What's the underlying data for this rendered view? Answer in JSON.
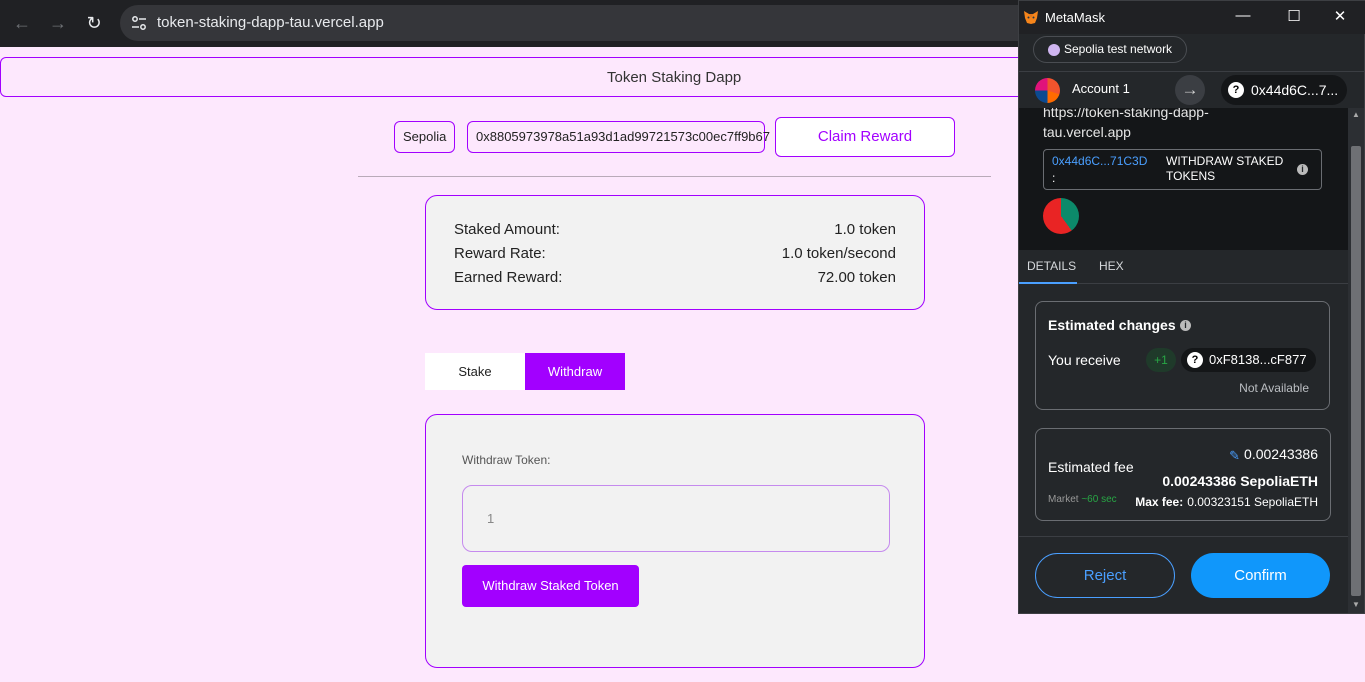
{
  "browser": {
    "url": "token-staking-dapp-tau.vercel.app"
  },
  "page": {
    "title": "Token Staking Dapp",
    "network_chip": "Sepolia",
    "address_chip": "0x8805973978a51a93d1ad99721573c00ec7ff9b67",
    "claim_reward_label": "Claim Reward",
    "stats": [
      {
        "label": "Staked Amount:",
        "value": "1.0 token"
      },
      {
        "label": "Reward Rate:",
        "value": "1.0 token/second"
      },
      {
        "label": "Earned Reward:",
        "value": "72.00 token"
      }
    ],
    "tabs": [
      {
        "label": "Stake"
      },
      {
        "label": "Withdraw"
      }
    ],
    "active_tab": "Withdraw",
    "withdraw": {
      "label": "Withdraw Token:",
      "input_value": "1",
      "button_label": "Withdraw Staked Token"
    }
  },
  "metamask": {
    "window_title": "MetaMask",
    "window_controls": {
      "minimize": "—",
      "maximize": "☐",
      "close": "✕"
    },
    "network": "Sepolia test network",
    "account_name": "Account 1",
    "account_address": "0x44d6C...7...",
    "origin": "https://token-staking-dapp-tau.vercel.app",
    "contract_address": "0x44d6C...71C3D",
    "contract_colon": ":",
    "method": "WITHDRAW STAKED TOKENS",
    "tabs": [
      "DETAILS",
      "HEX"
    ],
    "active_tab": "DETAILS",
    "estimated_changes": {
      "title": "Estimated changes",
      "you_receive_label": "You receive",
      "amount": "+1",
      "token_address": "0xF8138...cF877",
      "fiat_note": "Not Available"
    },
    "fee": {
      "title": "Estimated fee",
      "fiat_value": "0.00243386",
      "eth_value": "0.00243386 SepoliaETH",
      "market_label": "Market",
      "market_time": "~60 sec",
      "max_fee_label": "Max fee:",
      "max_fee_value": "0.00323151 SepoliaETH"
    },
    "reject_label": "Reject",
    "confirm_label": "Confirm"
  },
  "colors": {
    "accent_purple": "#a200ff",
    "page_bg": "#fde8fd",
    "metamask_blue": "#1097fb",
    "metamask_bg": "#24272a"
  }
}
